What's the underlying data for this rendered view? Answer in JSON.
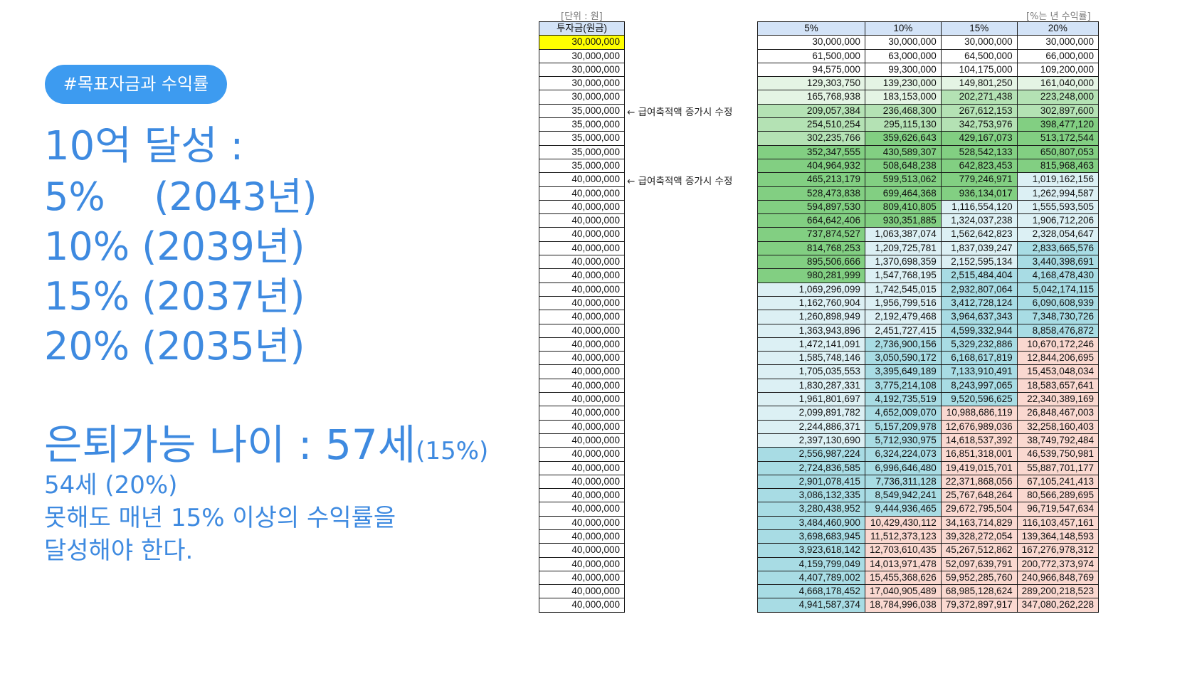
{
  "left": {
    "tag": "#목표자금과 수익률",
    "goal_title": "10억 달성 :",
    "goals": [
      "5%    (2043년)",
      "10% (2039년)",
      "15% (2037년)",
      "20% (2035년)"
    ],
    "retire_main": "은퇴가능 나이 : 57세",
    "retire_sub": "(15%)",
    "note_lines": [
      "54세 (20%)",
      "못해도 매년 15% 이상의 수익률을",
      "달성해야 한다."
    ]
  },
  "sheet": {
    "unit_left": "[단위 : 원]",
    "unit_right": "[%는 년 수익률]",
    "investment_header": "투자금(원금)",
    "return_headers": [
      "5%",
      "10%",
      "15%",
      "20%"
    ],
    "annotations": [
      {
        "text": "← 급여축적액 증가시 수정",
        "row": 5
      },
      {
        "text": "← 급여축적액 증가시 수정",
        "row": 10
      }
    ],
    "investment": [
      "30,000,000",
      "30,000,000",
      "30,000,000",
      "30,000,000",
      "30,000,000",
      "35,000,000",
      "35,000,000",
      "35,000,000",
      "35,000,000",
      "35,000,000",
      "40,000,000",
      "40,000,000",
      "40,000,000",
      "40,000,000",
      "40,000,000",
      "40,000,000",
      "40,000,000",
      "40,000,000",
      "40,000,000",
      "40,000,000",
      "40,000,000",
      "40,000,000",
      "40,000,000",
      "40,000,000",
      "40,000,000",
      "40,000,000",
      "40,000,000",
      "40,000,000",
      "40,000,000",
      "40,000,000",
      "40,000,000",
      "40,000,000",
      "40,000,000",
      "40,000,000",
      "40,000,000",
      "40,000,000",
      "40,000,000",
      "40,000,000",
      "40,000,000",
      "40,000,000",
      "40,000,000",
      "40,000,000"
    ],
    "returns": [
      [
        "30,000,000",
        "30,000,000",
        "30,000,000",
        "30,000,000"
      ],
      [
        "61,500,000",
        "63,000,000",
        "64,500,000",
        "66,000,000"
      ],
      [
        "94,575,000",
        "99,300,000",
        "104,175,000",
        "109,200,000"
      ],
      [
        "129,303,750",
        "139,230,000",
        "149,801,250",
        "161,040,000"
      ],
      [
        "165,768,938",
        "183,153,000",
        "202,271,438",
        "223,248,000"
      ],
      [
        "209,057,384",
        "236,468,300",
        "267,612,153",
        "302,897,600"
      ],
      [
        "254,510,254",
        "295,115,130",
        "342,753,976",
        "398,477,120"
      ],
      [
        "302,235,766",
        "359,626,643",
        "429,167,073",
        "513,172,544"
      ],
      [
        "352,347,555",
        "430,589,307",
        "528,542,133",
        "650,807,053"
      ],
      [
        "404,964,932",
        "508,648,238",
        "642,823,453",
        "815,968,463"
      ],
      [
        "465,213,179",
        "599,513,062",
        "779,246,971",
        "1,019,162,156"
      ],
      [
        "528,473,838",
        "699,464,368",
        "936,134,017",
        "1,262,994,587"
      ],
      [
        "594,897,530",
        "809,410,805",
        "1,116,554,120",
        "1,555,593,505"
      ],
      [
        "664,642,406",
        "930,351,885",
        "1,324,037,238",
        "1,906,712,206"
      ],
      [
        "737,874,527",
        "1,063,387,074",
        "1,562,642,823",
        "2,328,054,647"
      ],
      [
        "814,768,253",
        "1,209,725,781",
        "1,837,039,247",
        "2,833,665,576"
      ],
      [
        "895,506,666",
        "1,370,698,359",
        "2,152,595,134",
        "3,440,398,691"
      ],
      [
        "980,281,999",
        "1,547,768,195",
        "2,515,484,404",
        "4,168,478,430"
      ],
      [
        "1,069,296,099",
        "1,742,545,015",
        "2,932,807,064",
        "5,042,174,115"
      ],
      [
        "1,162,760,904",
        "1,956,799,516",
        "3,412,728,124",
        "6,090,608,939"
      ],
      [
        "1,260,898,949",
        "2,192,479,468",
        "3,964,637,343",
        "7,348,730,726"
      ],
      [
        "1,363,943,896",
        "2,451,727,415",
        "4,599,332,944",
        "8,858,476,872"
      ],
      [
        "1,472,141,091",
        "2,736,900,156",
        "5,329,232,886",
        "10,670,172,246"
      ],
      [
        "1,585,748,146",
        "3,050,590,172",
        "6,168,617,819",
        "12,844,206,695"
      ],
      [
        "1,705,035,553",
        "3,395,649,189",
        "7,133,910,491",
        "15,453,048,034"
      ],
      [
        "1,830,287,331",
        "3,775,214,108",
        "8,243,997,065",
        "18,583,657,641"
      ],
      [
        "1,961,801,697",
        "4,192,735,519",
        "9,520,596,625",
        "22,340,389,169"
      ],
      [
        "2,099,891,782",
        "4,652,009,070",
        "10,988,686,119",
        "26,848,467,003"
      ],
      [
        "2,244,886,371",
        "5,157,209,978",
        "12,676,989,036",
        "32,258,160,403"
      ],
      [
        "2,397,130,690",
        "5,712,930,975",
        "14,618,537,392",
        "38,749,792,484"
      ],
      [
        "2,556,987,224",
        "6,324,224,073",
        "16,851,318,001",
        "46,539,750,981"
      ],
      [
        "2,724,836,585",
        "6,996,646,480",
        "19,419,015,701",
        "55,887,701,177"
      ],
      [
        "2,901,078,415",
        "7,736,311,128",
        "22,371,868,056",
        "67,105,241,413"
      ],
      [
        "3,086,132,335",
        "8,549,942,241",
        "25,767,648,264",
        "80,566,289,695"
      ],
      [
        "3,280,438,952",
        "9,444,936,465",
        "29,672,795,504",
        "96,719,547,634"
      ],
      [
        "3,484,460,900",
        "10,429,430,112",
        "34,163,714,829",
        "116,103,457,161"
      ],
      [
        "3,698,683,945",
        "11,512,373,123",
        "39,328,272,054",
        "139,364,148,593"
      ],
      [
        "3,923,618,142",
        "12,703,610,435",
        "45,267,512,862",
        "167,276,978,312"
      ],
      [
        "4,159,799,049",
        "14,013,971,478",
        "52,097,639,791",
        "200,772,373,974"
      ],
      [
        "4,407,789,002",
        "15,455,368,626",
        "59,952,285,760",
        "240,966,848,769"
      ],
      [
        "4,668,178,452",
        "17,040,905,489",
        "68,985,128,624",
        "289,200,218,523"
      ],
      [
        "4,941,587,374",
        "18,784,996,038",
        "79,372,897,917",
        "347,080,262,228"
      ]
    ],
    "colors": {
      "highlight": "#ffff00",
      "header": "#d3e3f7",
      "green_light": "#e4f4e4",
      "green_mid": "#b4e2b4",
      "green_dark": "#82cf82",
      "teal_light": "#dcf0f4",
      "teal_dark": "#a8dce4",
      "pink": "#fad8d0",
      "text_blue": "#3e8ae0",
      "tag_blue": "#3d9bf0"
    }
  }
}
